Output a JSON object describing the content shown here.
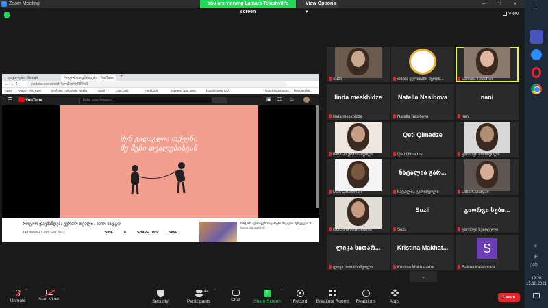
{
  "window": {
    "title": "Zoom Meeting",
    "banner": "You are viewing Lamara Telashvili's screen",
    "view_options": "View Options ▾"
  },
  "topbar": {
    "view_label": "View"
  },
  "browser": {
    "tabs": [
      "დავალება - Google",
      "როგორ დავშანდება - YouTube"
    ],
    "url": "youtube.com/watch?v=bTmHcT8Yw8",
    "bookmarks": [
      "Apps",
      "Video - YouTube",
      "ადრისი Facebook",
      "Netflix",
      "Adult",
      "Lulu Lulu",
      "Facebook",
      "Торрент Для всех",
      "Loyal Nanny DD...",
      "Other bookmarks",
      "Reading list"
    ],
    "yt_search_placeholder": "Enter your keyword",
    "video_caption_1": "შენ გადაგდია თქვენი",
    "video_caption_2": "მე შენი თვალებისგან",
    "video_title": "როგორ დავშანდება უერთო თვალი / ისიო სადგო",
    "video_meta": "148 views • 5 окт. Feb 2022",
    "actions": [
      "NINE",
      "0",
      "SHARE THIS",
      "SAVE"
    ],
    "rec_title": "როგორ აქარაყერ საგარები მსგავსი შეჩვევება B...",
    "rec_channel": "Tamar Santiashvili"
  },
  "participants": [
    {
      "name": "Suzii",
      "type": "photo",
      "big": ""
    },
    {
      "name": "თათა ყურსიაჩი მერის...",
      "type": "logo",
      "big": ""
    },
    {
      "name": "Lamara Telashvili",
      "type": "photo",
      "big": ""
    },
    {
      "name": "linda meskhidze",
      "type": "text",
      "big": "linda meskhidze"
    },
    {
      "name": "Natella Nasibova",
      "type": "text",
      "big": "Natella Nasibova"
    },
    {
      "name": "nani",
      "type": "text",
      "big": "nani"
    },
    {
      "name": "მარიამ ქორჩაშვილი",
      "type": "photo",
      "big": ""
    },
    {
      "name": "Qeti Qimadze",
      "type": "text",
      "big": "Qeti Qimadze"
    },
    {
      "name": "გიორგი ბიძიშვილი",
      "type": "photo",
      "big": ""
    },
    {
      "name": "Mari Oxbnelyan",
      "type": "photo",
      "big": ""
    },
    {
      "name": "ნატალია გარიშვილი",
      "type": "text",
      "big": "ნატალია გარ..."
    },
    {
      "name": "Lidia Kazaryan",
      "type": "photo",
      "big": ""
    },
    {
      "name": "Gulchina Akhmedova",
      "type": "photo",
      "big": ""
    },
    {
      "name": "Suzii",
      "type": "text",
      "big": "Suzii"
    },
    {
      "name": "გიორგი სუბიტული",
      "type": "text",
      "big": "გიორგი სუბი..."
    },
    {
      "name": "ლიკა სითარიშვილი",
      "type": "text",
      "big": "ლიკა სითარ..."
    },
    {
      "name": "Kristina Makhatadze",
      "type": "text",
      "big": "Kristina Makhat..."
    },
    {
      "name": "Sakina Kalashova",
      "type": "avatar",
      "big": "S"
    }
  ],
  "toolbar": {
    "unmute": "Unmute",
    "start_video": "Start Video",
    "security": "Security",
    "participants": "Participants",
    "participants_count": "44",
    "chat": "Chat",
    "share_screen": "Share Screen",
    "record": "Record",
    "breakout_rooms": "Breakout Rooms",
    "reactions": "Reactions",
    "apps": "Apps",
    "leave": "Leave"
  },
  "tray": {
    "lang": "ქარ",
    "time": "19:26",
    "date": "15.10.2021"
  },
  "colors": {
    "active_speaker": "#e4f54a",
    "share_green": "#23d959",
    "leave_red": "#e02828",
    "video_bg": "#f29d8e"
  }
}
